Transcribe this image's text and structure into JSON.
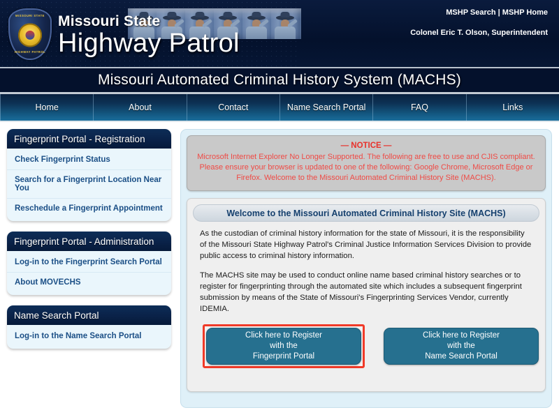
{
  "header": {
    "agency_line1": "Missouri State",
    "agency_line2": "Highway Patrol",
    "badge_top_text": "MISSOURI STATE",
    "badge_bottom_text": "HIGHWAY PATROL",
    "links": {
      "search": "MSHP Search",
      "separator": " | ",
      "home": "MSHP Home"
    },
    "superintendent": "Colonel Eric T. Olson, Superintendent"
  },
  "system_title": "Missouri Automated Criminal History System (MACHS)",
  "nav": {
    "items": [
      {
        "label": "Home"
      },
      {
        "label": "About"
      },
      {
        "label": "Contact"
      },
      {
        "label": "Name Search Portal"
      },
      {
        "label": "FAQ"
      },
      {
        "label": "Links"
      }
    ]
  },
  "sidebar": {
    "panels": [
      {
        "title": "Fingerprint Portal - Registration",
        "links": [
          "Check Fingerprint Status",
          "Search for a Fingerprint Location Near You",
          "Reschedule a Fingerprint Appointment"
        ]
      },
      {
        "title": "Fingerprint Portal - Administration",
        "links": [
          "Log-in to the Fingerprint Search Portal",
          "About MOVECHS"
        ]
      },
      {
        "title": "Name Search Portal",
        "links": [
          "Log-in to the Name Search Portal"
        ]
      }
    ]
  },
  "notice": {
    "title": "— NOTICE —",
    "text": "Microsoft Internet Explorer No Longer Supported. The following are free to use and CJIS compliant. Please ensure your browser is updated to one of the following: Google Chrome, Microsoft Edge or Firefox. Welcome to the Missouri Automated Criminal History Site (MACHS)."
  },
  "welcome": {
    "heading": "Welcome to the Missouri Automated Criminal History Site (MACHS)",
    "paragraph1": "As the custodian of criminal history information for the state of Missouri, it is the responsibility of the Missouri State Highway Patrol's Criminal Justice Information Services Division to provide public access to criminal history information.",
    "paragraph2": "The MACHS site may be used to conduct online name based criminal history searches or to register for fingerprinting through the automated site which includes a subsequent fingerprint submission by means of the State of Missouri's Fingerprinting Services Vendor, currently IDEMIA."
  },
  "cta": {
    "fingerprint": {
      "line1": "Click here to Register",
      "line2": "with the",
      "line3": "Fingerprint Portal",
      "highlighted": true
    },
    "name_search": {
      "line1": "Click here to Register",
      "line2": "with the",
      "line3": "Name Search Portal",
      "highlighted": false
    }
  },
  "colors": {
    "header_navy": "#04112c",
    "nav_blue": "#135881",
    "panel_header_navy": "#0a2248",
    "panel_body_lightblue": "#eaf6fc",
    "link_blue": "#1b4f86",
    "notice_red": "#ef4a45",
    "notice_gray": "#c9c9c9",
    "content_bg": "#dff0f8",
    "cta_teal": "#26708f",
    "highlight_red": "#f03a28"
  }
}
